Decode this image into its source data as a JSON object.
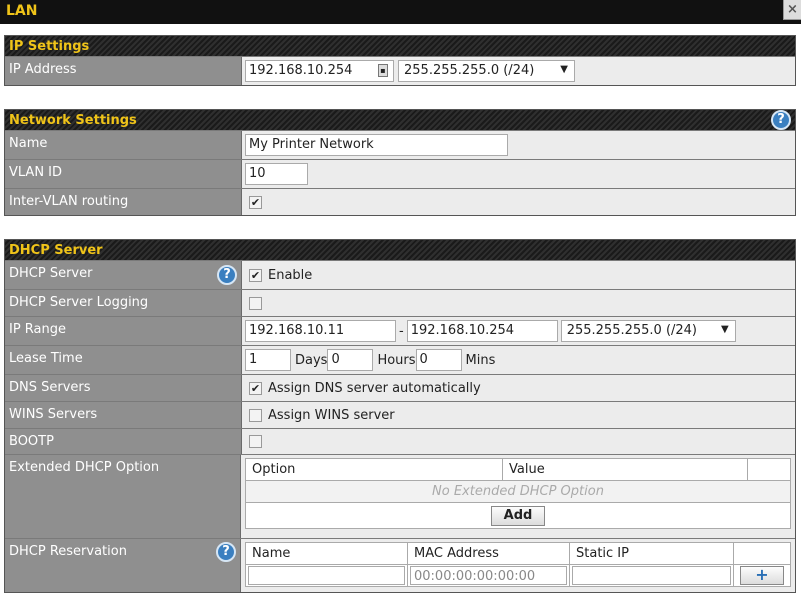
{
  "window": {
    "title": "LAN",
    "close_glyph": "×"
  },
  "ip_settings": {
    "header": "IP Settings",
    "ip_address_label": "IP Address",
    "ip_address_value": "192.168.10.254",
    "subnet": "255.255.255.0 (/24)"
  },
  "network_settings": {
    "header": "Network Settings",
    "help_glyph": "?",
    "name_label": "Name",
    "name_value": "My Printer Network",
    "vlan_label": "VLAN ID",
    "vlan_value": "10",
    "intervlan_label": "Inter-VLAN routing",
    "intervlan_checked": "✔"
  },
  "dhcp": {
    "header": "DHCP Server",
    "help_glyph": "?",
    "server_label": "DHCP Server",
    "server_checked": "✔",
    "server_enable_text": "Enable",
    "logging_label": "DHCP Server Logging",
    "range_label": "IP Range",
    "range_start": "192.168.10.11",
    "range_sep": "-",
    "range_end": "192.168.10.254",
    "range_subnet": "255.255.255.0 (/24)",
    "lease_label": "Lease Time",
    "lease_days": "1",
    "days_unit": "Days",
    "lease_hours": "0",
    "hours_unit": "Hours",
    "lease_mins": "0",
    "mins_unit": "Mins",
    "dns_label": "DNS Servers",
    "dns_checked": "✔",
    "dns_text": "Assign DNS server automatically",
    "wins_label": "WINS Servers",
    "wins_text": "Assign WINS server",
    "bootp_label": "BOOTP",
    "ext_label": "Extended DHCP Option",
    "ext_col_option": "Option",
    "ext_col_value": "Value",
    "ext_empty": "No Extended DHCP Option",
    "ext_add": "Add",
    "res_label": "DHCP Reservation",
    "res_col_name": "Name",
    "res_col_mac": "MAC Address",
    "res_col_ip": "Static IP",
    "res_mac_placeholder": "00:00:00:00:00:00",
    "res_add_glyph": "+"
  },
  "colors": {
    "accent": "#f0c419",
    "help": "#3a7fc0",
    "label_bg": "#8f8f8f"
  }
}
